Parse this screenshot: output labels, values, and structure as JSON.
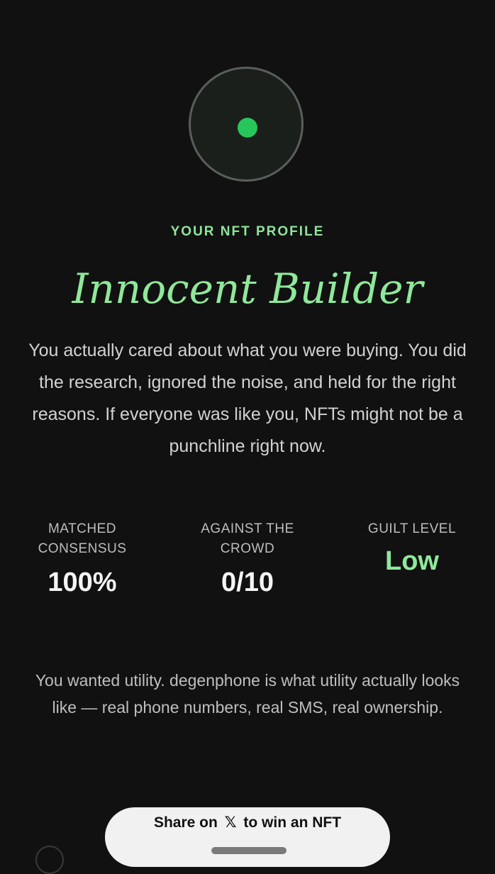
{
  "profile": {
    "eyebrow": "YOUR NFT PROFILE",
    "title": "Innocent Builder",
    "description": "You actually cared about what you were buying. You did the research, ignored the noise, and held for the right reasons. If everyone was like you, NFTs might not be a punchline right now."
  },
  "stats": [
    {
      "label": "MATCHED CONSENSUS",
      "value": "100%"
    },
    {
      "label": "AGAINST THE CROWD",
      "value": "0/10"
    },
    {
      "label": "GUILT LEVEL",
      "value": "Low"
    }
  ],
  "cta": {
    "copy": "You wanted utility. degenphone is what utility actually looks like — real phone numbers, real SMS, real ownership.",
    "share_prefix": "Share on",
    "share_icon": "𝕏",
    "share_suffix": "to win an NFT"
  },
  "colors": {
    "background": "#111111",
    "accent": "#8fe89a",
    "dot": "#27c65a"
  }
}
